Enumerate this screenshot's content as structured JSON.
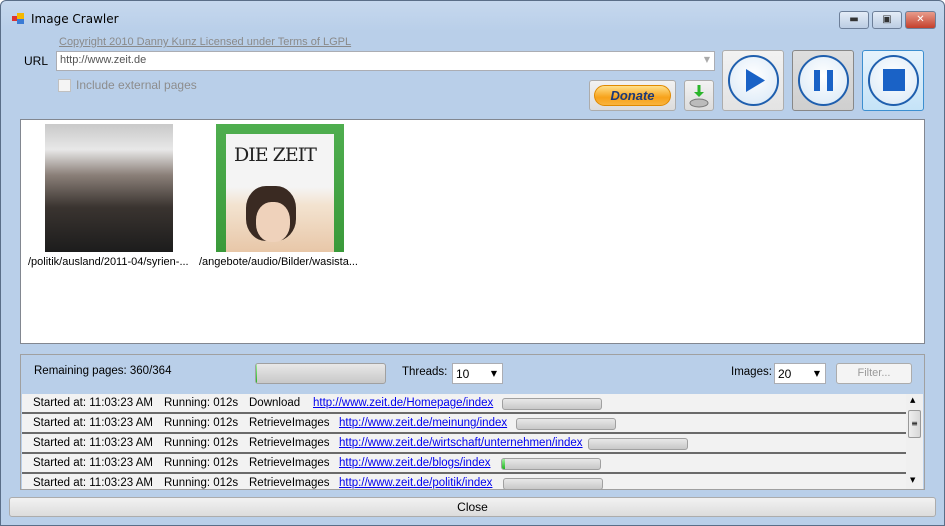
{
  "window": {
    "title": "Image Crawler",
    "minimize_icon": "minimize-icon",
    "maximize_icon": "maximize-icon",
    "close_icon": "close-icon"
  },
  "header": {
    "copyright": "Copyright 2010 Danny Kunz  Licensed under Terms of LGPL",
    "url_label": "URL",
    "url_value": "http://www.zeit.de",
    "include_external_label": "Include external pages",
    "include_external_checked": false,
    "donate_label": "Donate",
    "download_icon": "download-disk-icon",
    "play_icon": "play-icon",
    "pause_icon": "pause-icon",
    "stop_icon": "stop-icon"
  },
  "images": [
    {
      "caption": "/politik/ausland/2011-04/syrien-..."
    },
    {
      "caption": "/angebote/audio/Bilder/wasista...",
      "logo_text": "DIE ZEIT"
    }
  ],
  "status": {
    "remaining_label": "Remaining pages: 360/364",
    "overall_progress": 0.01,
    "threads_label": "Threads:",
    "threads_value": "10",
    "images_label": "Images:",
    "images_value": "20",
    "filter_label": "Filter..."
  },
  "jobs": [
    {
      "started": "Started at: 11:03:23 AM",
      "running": "Running: 012s",
      "action": "Download",
      "url": "http://www.zeit.de/Homepage/index",
      "progress": 0
    },
    {
      "started": "Started at: 11:03:23 AM",
      "running": "Running: 012s",
      "action": "RetrieveImages",
      "url": "http://www.zeit.de/meinung/index",
      "progress": 0
    },
    {
      "started": "Started at: 11:03:23 AM",
      "running": "Running: 012s",
      "action": "RetrieveImages",
      "url": "http://www.zeit.de/wirtschaft/unternehmen/index",
      "progress": 0
    },
    {
      "started": "Started at: 11:03:23 AM",
      "running": "Running: 012s",
      "action": "RetrieveImages",
      "url": "http://www.zeit.de/blogs/index",
      "progress": 0.03
    },
    {
      "started": "Started at: 11:03:23 AM",
      "running": "Running: 012s",
      "action": "RetrieveImages",
      "url": "http://www.zeit.de/politik/index",
      "progress": 0
    }
  ],
  "footer": {
    "close_label": "Close"
  }
}
